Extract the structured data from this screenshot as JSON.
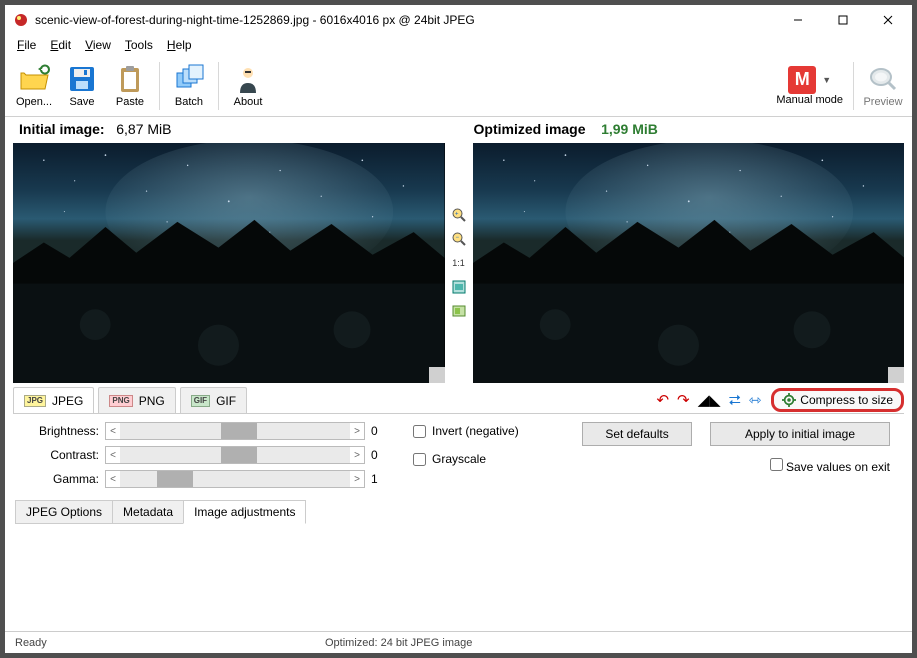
{
  "window": {
    "title": "scenic-view-of-forest-during-night-time-1252869.jpg - 6016x4016 px @ 24bit JPEG"
  },
  "menu": {
    "file": "File",
    "edit": "Edit",
    "view": "View",
    "tools": "Tools",
    "help": "Help"
  },
  "toolbar": {
    "open": "Open...",
    "save": "Save",
    "paste": "Paste",
    "batch": "Batch",
    "about": "About",
    "mode": "Manual mode",
    "mode_letter": "M",
    "preview": "Preview"
  },
  "info": {
    "initial_label": "Initial image:",
    "initial_size": "6,87 MiB",
    "optimized_label": "Optimized image",
    "optimized_size": "1,99 MiB"
  },
  "mid_tools": {
    "ratio": "1:1"
  },
  "format_tabs": {
    "jpeg": "JPEG",
    "png": "PNG",
    "gif": "GIF"
  },
  "compress": "Compress to size",
  "adjust": {
    "brightness_label": "Brightness:",
    "brightness_val": "0",
    "contrast_label": "Contrast:",
    "contrast_val": "0",
    "gamma_label": "Gamma:",
    "gamma_val": "1",
    "invert": "Invert (negative)",
    "grayscale": "Grayscale",
    "set_defaults": "Set defaults",
    "apply": "Apply to initial image",
    "save_on_exit": "Save values on exit"
  },
  "bottom_tabs": {
    "jpeg_opts": "JPEG Options",
    "metadata": "Metadata",
    "image_adj": "Image adjustments"
  },
  "status": {
    "ready": "Ready",
    "opt": "Optimized: 24 bit JPEG image"
  },
  "icons": {
    "zoom_in": "zoom-in-icon",
    "zoom_out": "zoom-out-icon",
    "fit": "fit-icon",
    "original": "original-size-icon",
    "undo": "↶",
    "redo": "↷"
  }
}
